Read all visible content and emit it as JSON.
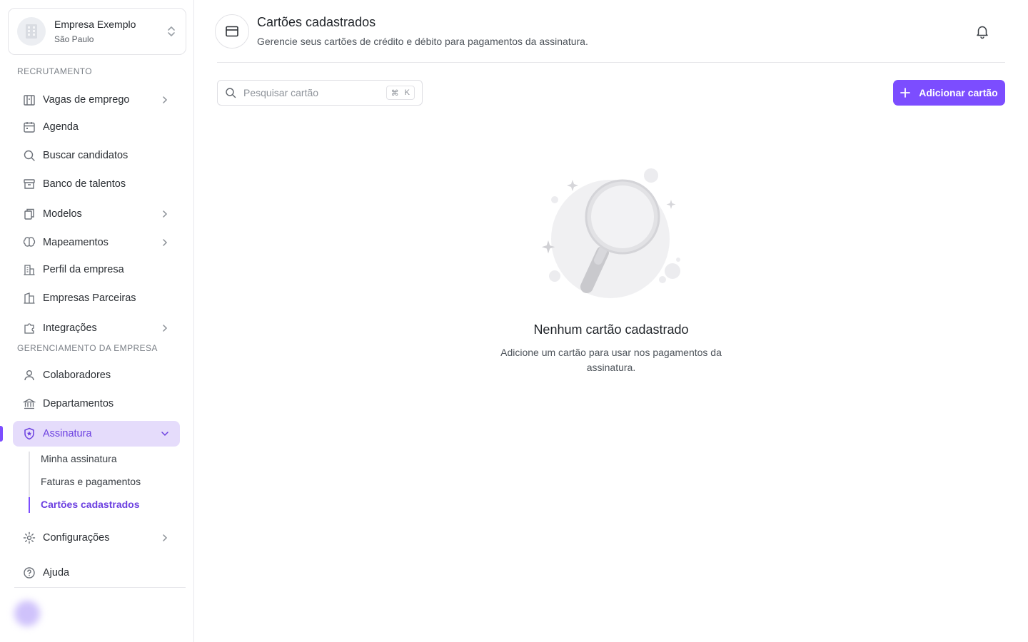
{
  "company": {
    "name": "Empresa Exemplo",
    "city": "São Paulo"
  },
  "sidebar": {
    "sections": {
      "recruitment": "RECRUTAMENTO",
      "management": "GERENCIAMENTO DA EMPRESA"
    },
    "items": [
      {
        "label": "Vagas de emprego",
        "icon": "building-icon",
        "expandable": true
      },
      {
        "label": "Agenda",
        "icon": "calendar-icon",
        "expandable": false
      },
      {
        "label": "Buscar candidatos",
        "icon": "search-icon",
        "expandable": false
      },
      {
        "label": "Banco de talentos",
        "icon": "archive-icon",
        "expandable": false
      },
      {
        "label": "Modelos",
        "icon": "copy-icon",
        "expandable": true
      },
      {
        "label": "Mapeamentos",
        "icon": "brain-icon",
        "expandable": true
      },
      {
        "label": "Perfil da empresa",
        "icon": "company-profile-icon",
        "expandable": false
      },
      {
        "label": "Empresas Parceiras",
        "icon": "buildings-icon",
        "expandable": false
      },
      {
        "label": "Integrações",
        "icon": "puzzle-icon",
        "expandable": true
      },
      {
        "label": "Colaboradores",
        "icon": "user-icon",
        "expandable": false
      },
      {
        "label": "Departamentos",
        "icon": "bank-icon",
        "expandable": false
      },
      {
        "label": "Assinatura",
        "icon": "shield-star-icon",
        "expandable": true,
        "active": true
      },
      {
        "label": "Configurações",
        "icon": "gear-icon",
        "expandable": true
      },
      {
        "label": "Ajuda",
        "icon": "help-circle-icon",
        "expandable": false
      }
    ],
    "subscription_subitems": [
      {
        "label": "Minha assinatura"
      },
      {
        "label": "Faturas e pagamentos"
      },
      {
        "label": "Cartões cadastrados",
        "active": true
      }
    ]
  },
  "header": {
    "title": "Cartões cadastrados",
    "subtitle": "Gerencie seus cartões de crédito e débito para pagamentos da assinatura."
  },
  "toolbar": {
    "search_placeholder": "Pesquisar cartão",
    "shortcut_symbol": "⌘",
    "shortcut_key": "K",
    "add_label": "Adicionar cartão"
  },
  "empty_state": {
    "title": "Nenhum cartão cadastrado",
    "description": "Adicione um cartão para usar nos pagamentos da assinatura."
  },
  "colors": {
    "accent": "#7c4dff",
    "active_bg": "#e5dcfb",
    "active_text": "#6b3fe0"
  }
}
